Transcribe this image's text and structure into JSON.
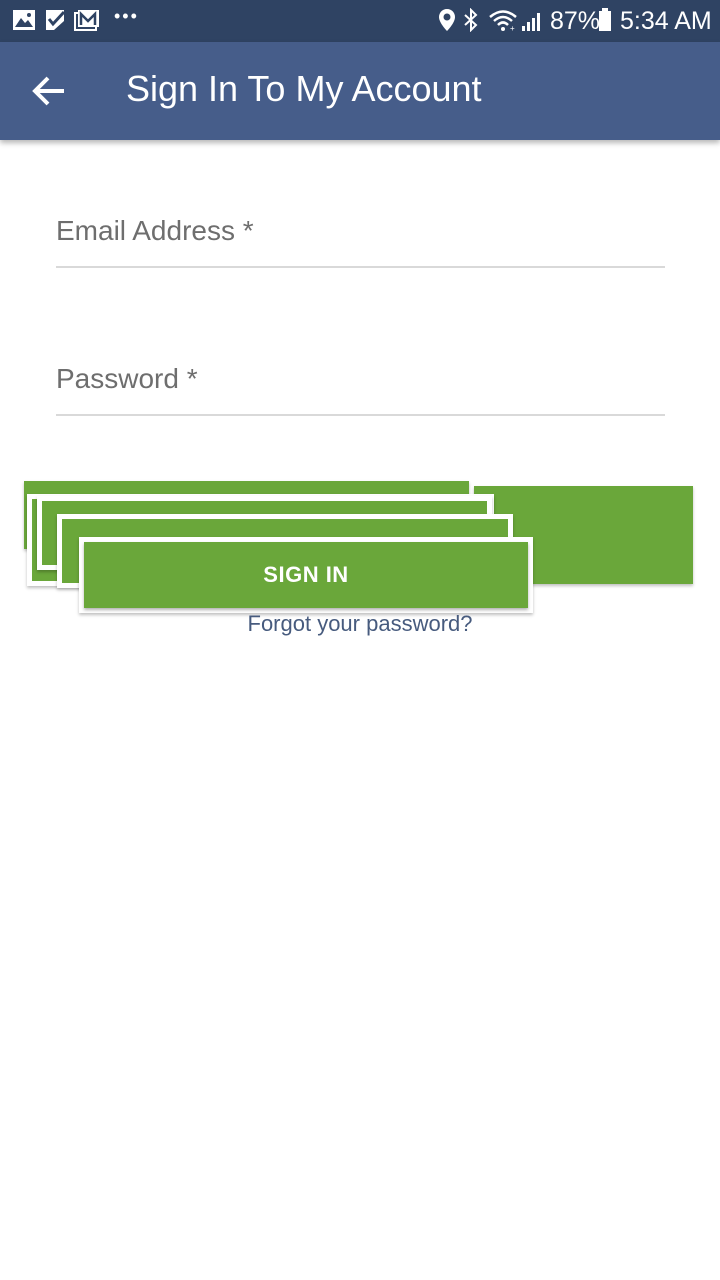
{
  "status_bar": {
    "battery": "87%",
    "time": "5:34 AM",
    "overflow": "•••",
    "icons": [
      "gallery-icon",
      "check-notification-icon",
      "mail-icon",
      "location-icon",
      "bluetooth-icon",
      "wifi-icon",
      "signal-icon",
      "battery-icon"
    ]
  },
  "app_bar": {
    "title": "Sign In To My Account",
    "back_icon": "arrow-left-icon"
  },
  "form": {
    "email_placeholder": "Email Address *",
    "password_placeholder": "Password *",
    "sign_in_label": "SIGN IN",
    "forgot_password_label": "Forgot your password?"
  },
  "colors": {
    "status_bar": "#2f4363",
    "app_bar": "#465d8a",
    "button": "#6aa73a",
    "link": "#475b7e",
    "underline": "#d9d9d9"
  }
}
